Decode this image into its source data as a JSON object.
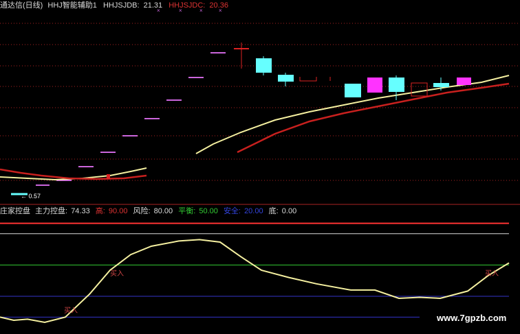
{
  "top_panel": {
    "header": {
      "prefix": "通达信(日线)",
      "indicator": "HHJ智能辅助1",
      "jdb_label": "HHJSJDB:",
      "jdb_value": "21.31",
      "jdc_label": "HHJSJDC:",
      "jdc_value": "20.36"
    },
    "min_label": "← 0.57",
    "colors": {
      "yellow": "#f5f0a0",
      "red": "#c8201e",
      "cyan": "#66ffff",
      "magenta": "#ff33ff",
      "purple_tick": "#cc66dd"
    }
  },
  "bottom_panel": {
    "header": {
      "name": "庄家控盘",
      "main_label": "主力控盘:",
      "main_value": "74.33",
      "high_label": "高:",
      "high_value": "90.00",
      "risk_label": "风险:",
      "risk_value": "80.00",
      "balance_label": "平衡:",
      "balance_value": "50.00",
      "safe_label": "安全:",
      "safe_value": "20.00",
      "bottom_label": "底:",
      "bottom_value": "0.00"
    },
    "buy_labels": [
      "买入",
      "买入",
      "买入"
    ],
    "colors": {
      "high": "#ff3333",
      "risk": "#dddddd",
      "balance": "#33cc33",
      "safe": "#3333cc",
      "line": "#f5f0a0",
      "label": "#cc4444"
    }
  },
  "watermark": "www.7gpzb.com",
  "chart_data": [
    {
      "type": "line",
      "title": "HHJ智能辅助1",
      "series": [
        {
          "name": "HHJSJDB",
          "color": "#f5f0a0",
          "points": [
            [
              0,
              258
            ],
            [
              40,
              260
            ],
            [
              80,
              262
            ],
            [
              120,
              260
            ],
            [
              160,
              256
            ],
            [
              190,
              250
            ],
            [
              213,
              245
            ],
            [
              213,
              null
            ],
            [
              285,
              224
            ],
            [
              310,
              210
            ],
            [
              350,
              193
            ],
            [
              400,
              175
            ],
            [
              450,
              163
            ],
            [
              500,
              153
            ],
            [
              550,
              143
            ],
            [
              600,
              135
            ],
            [
              650,
              127
            ],
            [
              700,
              120
            ],
            [
              740,
              110
            ]
          ]
        },
        {
          "name": "HHJSJDC",
          "color": "#c8201e",
          "points": [
            [
              0,
              247
            ],
            [
              30,
              252
            ],
            [
              60,
              256
            ],
            [
              100,
              260
            ],
            [
              140,
              261
            ],
            [
              180,
              260
            ],
            [
              213,
              256
            ],
            [
              213,
              null
            ],
            [
              345,
              222
            ],
            [
              400,
              195
            ],
            [
              450,
              177
            ],
            [
              500,
              165
            ],
            [
              550,
              155
            ],
            [
              600,
              145
            ],
            [
              650,
              135
            ],
            [
              700,
              128
            ],
            [
              740,
              122
            ]
          ]
        }
      ]
    },
    {
      "type": "line",
      "title": "庄家控盘",
      "x": [
        0,
        20,
        40,
        65,
        95,
        130,
        160,
        190,
        220,
        260,
        290,
        320,
        350,
        380,
        420,
        460,
        510,
        545,
        580,
        610,
        640,
        680,
        710,
        740
      ],
      "series": [
        {
          "name": "主力控盘",
          "values": [
            0,
            -3,
            -2,
            -5,
            0,
            22,
            45,
            60,
            68,
            73,
            74.33,
            72,
            58,
            45,
            38,
            32,
            26,
            26,
            18,
            19,
            18,
            25,
            40,
            52
          ]
        }
      ],
      "reference_lines": [
        {
          "name": "高",
          "value": 90
        },
        {
          "name": "风险",
          "value": 80
        },
        {
          "name": "平衡",
          "value": 50
        },
        {
          "name": "安全",
          "value": 20
        },
        {
          "name": "底",
          "value": 0
        }
      ],
      "ylim": [
        -5,
        95
      ]
    }
  ]
}
